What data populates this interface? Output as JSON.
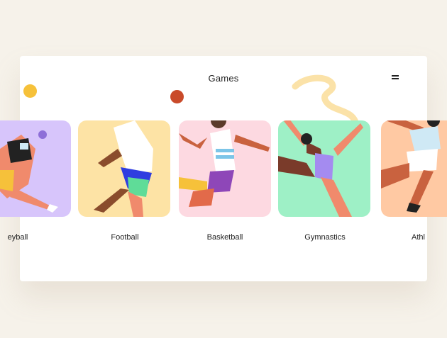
{
  "header": {
    "title": "Games",
    "menu_icon": "hamburger-icon"
  },
  "sports": [
    {
      "label": "eyball",
      "color": "#d7c5fb",
      "icon": "volleyball-player-illustration"
    },
    {
      "label": "Football",
      "color": "#fde3a5",
      "icon": "football-player-illustration"
    },
    {
      "label": "Basketball",
      "color": "#fdd9e1",
      "icon": "basketball-player-illustration"
    },
    {
      "label": "Gymnastics",
      "color": "#9ef0c6",
      "icon": "gymnast-illustration"
    },
    {
      "label": "Athl",
      "color": "#ffc9a3",
      "icon": "athlete-illustration"
    }
  ],
  "colors": {
    "background": "#f6f2ea",
    "card": "#ffffff",
    "text": "#222222"
  }
}
